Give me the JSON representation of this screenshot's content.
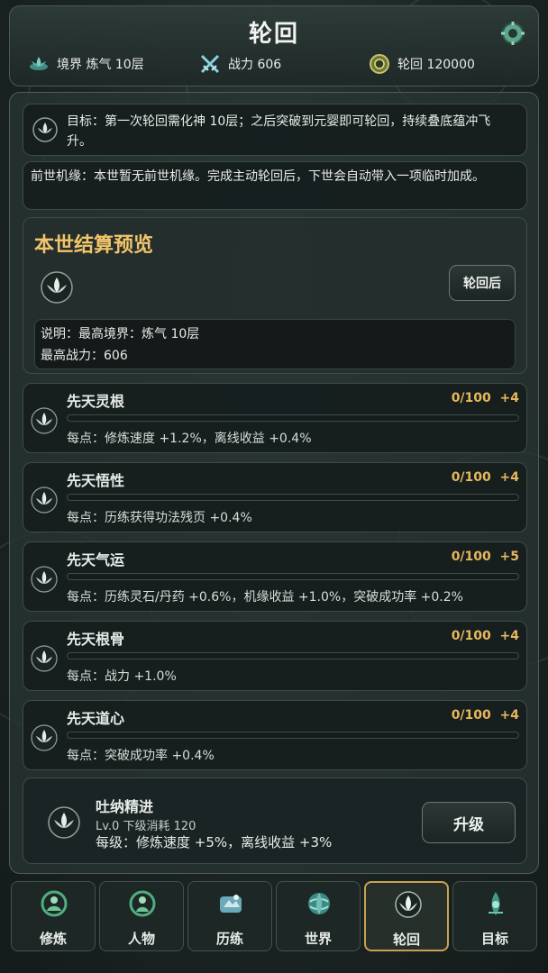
{
  "header": {
    "title": "轮回",
    "realm": "境界 炼气 10层",
    "power": "战力 606",
    "reincarnation_points": "轮回 120000"
  },
  "goal": {
    "text": "目标：第一次轮回需化神 10层；之后突破到元婴即可轮回，持续叠底蕴冲飞升。"
  },
  "past_life": {
    "text": "前世机缘：本世暂无前世机缘。完成主动轮回后，下世会自动带入一项临时加成。"
  },
  "preview": {
    "title": "本世结算预览",
    "button_label": "轮回后",
    "desc_line1": "说明：最高境界：炼气 10层",
    "desc_line2": "最高战力：606"
  },
  "attributes": [
    {
      "name": "先天灵根",
      "value": "0/100",
      "bonus": "+4",
      "progress": 0,
      "effect": "每点：修炼速度 +1.2%，离线收益 +0.4%"
    },
    {
      "name": "先天悟性",
      "value": "0/100",
      "bonus": "+4",
      "progress": 0,
      "effect": "每点：历练获得功法残页 +0.4%"
    },
    {
      "name": "先天气运",
      "value": "0/100",
      "bonus": "+5",
      "progress": 0,
      "effect": "每点：历练灵石/丹药 +0.6%，机缘收益 +1.0%，突破成功率 +0.2%"
    },
    {
      "name": "先天根骨",
      "value": "0/100",
      "bonus": "+4",
      "progress": 0,
      "effect": "每点：战力 +1.0%"
    },
    {
      "name": "先天道心",
      "value": "0/100",
      "bonus": "+4",
      "progress": 0,
      "effect": "每点：突破成功率 +0.4%"
    }
  ],
  "breathing": {
    "name": "吐纳精进",
    "level": "Lv.0  下级消耗 120",
    "effect": "每级：修炼速度 +5%，离线收益 +3%",
    "button_label": "升级"
  },
  "nav": {
    "tabs": [
      {
        "label": "修炼",
        "icon": "cultivation-icon"
      },
      {
        "label": "人物",
        "icon": "character-icon"
      },
      {
        "label": "历练",
        "icon": "adventure-icon"
      },
      {
        "label": "世界",
        "icon": "world-icon"
      },
      {
        "label": "轮回",
        "icon": "lotus-icon",
        "active": true
      },
      {
        "label": "目标",
        "icon": "goal-icon"
      }
    ]
  },
  "colors": {
    "accent_gold": "#f2c56a",
    "value_gold": "#e7b85c",
    "background": "#1b2524"
  }
}
